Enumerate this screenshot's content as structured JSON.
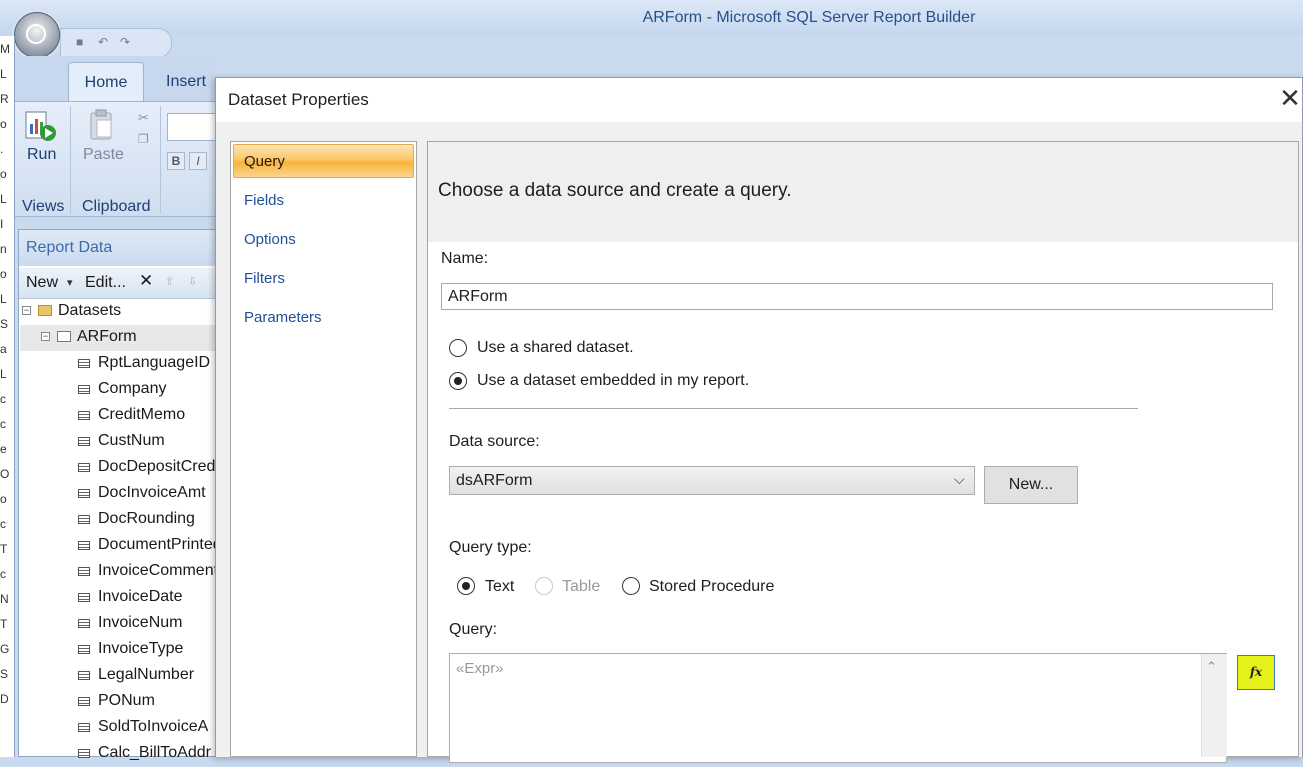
{
  "app": {
    "title": "ARForm - Microsoft SQL Server Report Builder",
    "tabs": [
      "Home",
      "Insert"
    ],
    "ribbon": {
      "run_label": "Run",
      "views_label": "Views",
      "paste_label": "Paste",
      "clipboard_label": "Clipboard",
      "bold_label": "B",
      "italic_label": "I"
    },
    "left_strip_chars": [
      "M",
      "L",
      "R",
      "o",
      ".",
      "o",
      "L",
      "I",
      "n",
      "o",
      "L",
      "S",
      "a",
      "L",
      "c",
      "c",
      "e",
      "O",
      "o",
      "c",
      "T",
      "c",
      "N",
      "T",
      "G",
      "S",
      "D"
    ]
  },
  "report_data": {
    "title": "Report Data",
    "toolbar": {
      "new_label": "New",
      "new_caret": "▾",
      "edit_label": "Edit...",
      "delete_glyph": "✕",
      "up_glyph": "⇧",
      "down_glyph": "⇩"
    },
    "tree": {
      "root_label": "Datasets",
      "dataset_label": "ARForm",
      "expander": "−",
      "fields": [
        "RptLanguageID",
        "Company",
        "CreditMemo",
        "CustNum",
        "DocDepositCred",
        "DocInvoiceAmt",
        "DocRounding",
        "DocumentPrinted",
        "InvoiceComment",
        "InvoiceDate",
        "InvoiceNum",
        "InvoiceType",
        "LegalNumber",
        "PONum",
        "SoldToInvoiceA",
        "Calc_BillToAddr"
      ]
    }
  },
  "dialog": {
    "title": "Dataset Properties",
    "close_glyph": "✕",
    "nav": [
      "Query",
      "Fields",
      "Options",
      "Filters",
      "Parameters"
    ],
    "selected_nav": "Query",
    "header_text": "Choose a data source and create a query.",
    "name_label": "Name:",
    "name_value": "ARForm",
    "source_options": [
      {
        "label": "Use a shared dataset.",
        "checked": false
      },
      {
        "label": "Use a dataset embedded in my report.",
        "checked": true
      }
    ],
    "datasource_label": "Data source:",
    "datasource_value": "dsARForm",
    "datasource_chevron": "⌵",
    "new_button_label": "New...",
    "query_type_label": "Query type:",
    "query_types": [
      {
        "label": "Text",
        "checked": true,
        "disabled": false
      },
      {
        "label": "Table",
        "checked": false,
        "disabled": true
      },
      {
        "label": "Stored Procedure",
        "checked": false,
        "disabled": false
      }
    ],
    "query_label": "Query:",
    "query_placeholder": "«Expr»",
    "scroll_up_glyph": "⌃",
    "fx_label": "fx"
  },
  "colors": {
    "accent": "#f9b43a",
    "link": "#1f4f9a",
    "highlight": "#e6f21c"
  }
}
